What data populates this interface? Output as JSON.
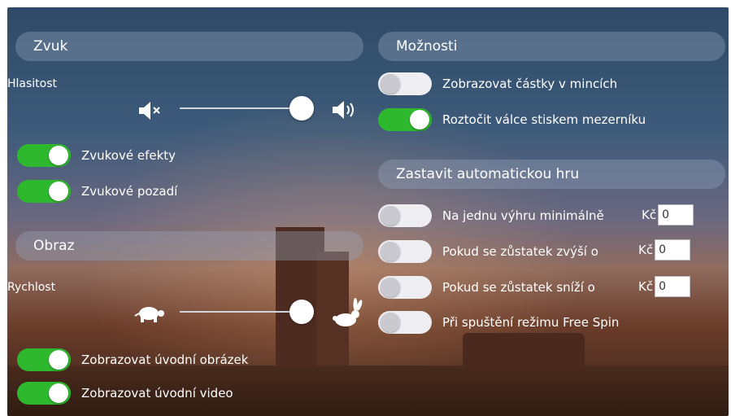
{
  "sound": {
    "title": "Zvuk",
    "volume_label": "Hlasitost",
    "volume_level": 1.0,
    "mute_icon": "speaker-mute-icon",
    "loud_icon": "speaker-loud-icon",
    "effects_label": "Zvukové efekty",
    "effects_on": true,
    "background_label": "Zvukové pozadí",
    "background_on": true
  },
  "image": {
    "title": "Obraz",
    "speed_label": "Rychlost",
    "speed_level": 1.0,
    "slow_icon": "turtle-icon",
    "fast_icon": "rabbit-icon",
    "intro_image_label": "Zobrazovat úvodní obrázek",
    "intro_image_on": true,
    "intro_video_label": "Zobrazovat úvodní video",
    "intro_video_on": true
  },
  "options": {
    "title": "Možnosti",
    "coins_label": "Zobrazovat částky v mincích",
    "coins_on": false,
    "spacebar_label": "Roztočit válce stiskem mezerníku",
    "spacebar_on": true
  },
  "autoplay": {
    "title": "Zastavit automatickou hru",
    "currency": "Kč",
    "win_label": "Na jednu výhru minimálně",
    "win_on": false,
    "win_value": "0",
    "increase_label": "Pokud se zůstatek zvýší o",
    "increase_on": false,
    "increase_value": "0",
    "decrease_label": "Pokud se zůstatek sníží o",
    "decrease_on": false,
    "decrease_value": "0",
    "freespin_label": "Při spuštění režimu Free Spin",
    "freespin_on": false
  },
  "colors": {
    "toggle_on": "#2eb82e",
    "toggle_off": "#eeeef2",
    "header_bg": "rgba(150,165,190,0.38)"
  }
}
